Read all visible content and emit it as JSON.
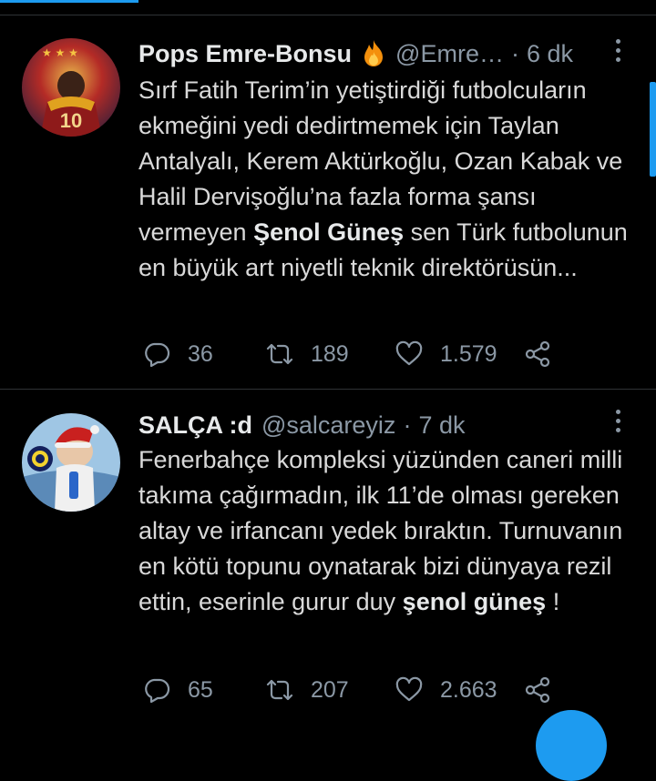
{
  "tweets": [
    {
      "display_name": "Pops Emre-Bonsu",
      "has_fire_emoji": true,
      "handle": "@Emre…",
      "time": "6 dk",
      "text_before": "Sırf Fatih Terim’in yetiştirdiği futbolcuların ekmeğini yedi dedirtmemek için Taylan Antalyalı, Kerem Aktürkoğlu, Ozan Kabak ve Halil Dervişoğlu’na fazla forma şansı vermeyen ",
      "text_bold": "Şenol Güneş",
      "text_after": " sen Türk futbolunun en büyük art niyetli teknik direktörüsün...",
      "avatar_number": "10",
      "replies": "36",
      "retweets": "189",
      "likes": "1.579"
    },
    {
      "display_name": "SALÇA :d",
      "handle": "@salcareyiz",
      "time": "7 dk",
      "text_before": "Fenerbahçe kompleksi yüzünden caneri milli takıma çağırmadın, ilk 11’de olması gereken altay ve irfancanı yedek bıraktın. Turnuvanın en kötü topunu oynatarak bizi dünyaya rezil ettin, eserinle gurur duy ",
      "text_bold": "şenol güneş",
      "text_after": " !",
      "replies": "65",
      "retweets": "207",
      "likes": "2.663"
    }
  ],
  "colors": {
    "background": "#000000",
    "text": "#d9d9d9",
    "muted": "#8b98a5",
    "accent": "#1d9bf0",
    "divider": "#2f3336"
  },
  "icons": [
    "reply-icon",
    "retweet-icon",
    "like-icon",
    "share-icon",
    "more-icon",
    "fire-emoji-icon"
  ]
}
